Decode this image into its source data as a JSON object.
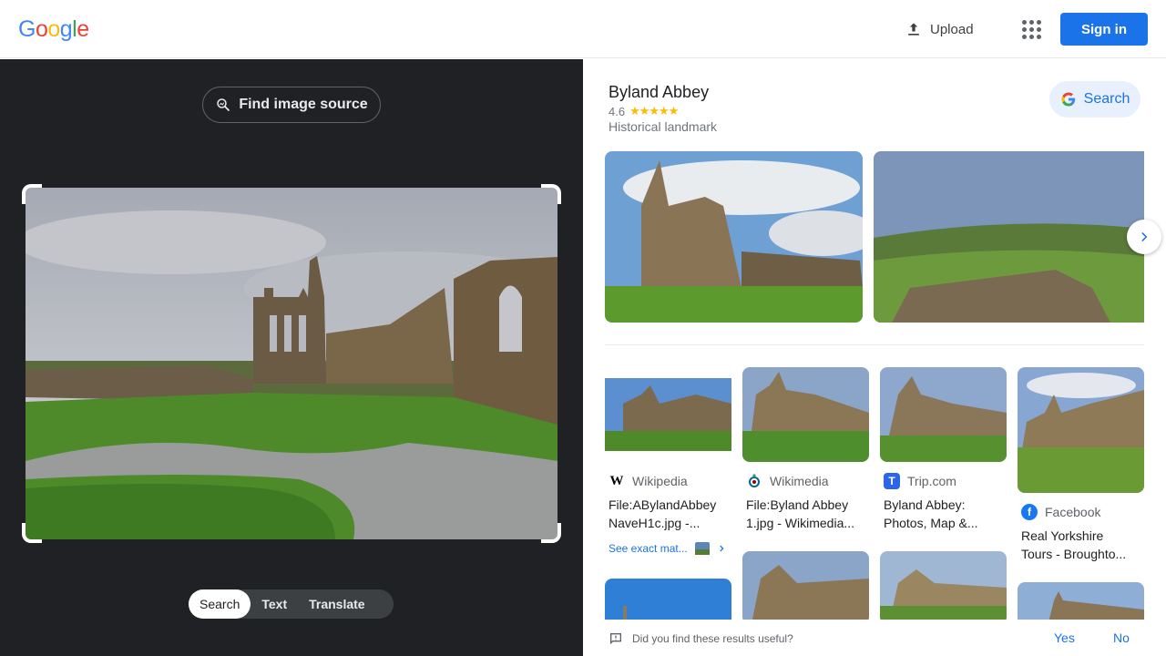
{
  "header": {
    "logo_letters": [
      "G",
      "o",
      "o",
      "g",
      "l",
      "e"
    ],
    "logo_colors": [
      "#4285f4",
      "#ea4335",
      "#fbbc05",
      "#4285f4",
      "#34a853",
      "#ea4335"
    ],
    "upload_label": "Upload",
    "apps_icon": "apps-grid-icon",
    "signin_label": "Sign in"
  },
  "left": {
    "find_source_label": "Find image source",
    "modes": [
      "Search",
      "Text",
      "Translate"
    ],
    "active_mode": "Search"
  },
  "knowledge_panel": {
    "title": "Byland Abbey",
    "rating": "4.6",
    "stars": "★★★★★",
    "type": "Historical landmark",
    "search_label": "Search"
  },
  "results": [
    {
      "source": "Wikipedia",
      "title_line1": "File:ABylandAbbey",
      "title_line2": "NaveH1c.jpg -...",
      "icon": "wikipedia-icon"
    },
    {
      "source": "Wikimedia",
      "title_line1": "File:Byland Abbey",
      "title_line2": "1.jpg - Wikimedia...",
      "icon": "wikimedia-icon"
    },
    {
      "source": "Trip.com",
      "title_line1": "Byland Abbey:",
      "title_line2": "Photos, Map &...",
      "icon": "tripcom-icon"
    },
    {
      "source": "Facebook",
      "title_line1": "Real Yorkshire",
      "title_line2": "Tours - Broughto...",
      "icon": "facebook-icon"
    }
  ],
  "exact_matches_label": "See exact mat...",
  "feedback": {
    "question": "Did you find these results useful?",
    "yes": "Yes",
    "no": "No"
  }
}
